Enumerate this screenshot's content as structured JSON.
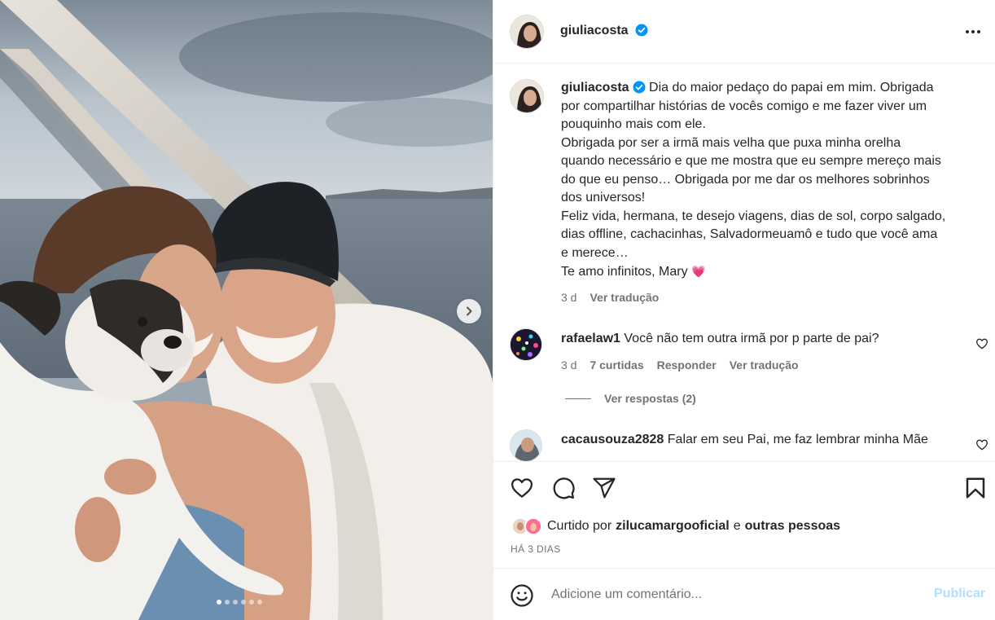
{
  "post": {
    "username": "giuliacosta",
    "verified": true,
    "caption_lines": [
      "Dia do maior pedaço do papai em mim. Obrigada",
      "por compartilhar histórias de vocês comigo e me fazer viver um",
      "pouquinho mais com ele.",
      "Obrigada por ser a irmã mais velha que puxa minha orelha",
      "quando necessário e que me mostra que eu sempre mereço mais",
      "do que eu penso… Obrigada por me dar os melhores sobrinhos",
      "dos universos!",
      "Feliz vida, hermana, te desejo viagens, dias de sol, corpo salgado,",
      "dias offline, cachacinhas, Salvadormeuamô e tudo que você ama",
      "e merece…",
      "Te amo infinitos, Mary"
    ],
    "caption_emoji": "💗",
    "caption_time": "3 d",
    "caption_translate": "Ver tradução",
    "carousel": {
      "slides": 6,
      "active_index": 0
    }
  },
  "comments": [
    {
      "username": "rafaelaw1",
      "text": "Você não tem outra irmã por p parte de pai?",
      "time": "3 d",
      "likes": "7 curtidas",
      "reply": "Responder",
      "translate": "Ver tradução",
      "view_replies": "Ver respostas (2)"
    },
    {
      "username": "cacausouza2828",
      "text": "Falar em seu Pai, me faz lembrar minha Mãe"
    }
  ],
  "likes": {
    "prefix": "Curtido por",
    "user": "zilucamargooficial",
    "connector": "e",
    "others": "outras pessoas"
  },
  "posted_time": "HÁ 3 DIAS",
  "add_comment": {
    "placeholder": "Adicione um comentário...",
    "publish": "Publicar"
  },
  "icons": {
    "more": "more-horizontal-icon",
    "like": "heart-icon",
    "comment": "comment-icon",
    "share": "paper-plane-icon",
    "save": "bookmark-icon",
    "emoji": "smiley-icon",
    "next": "chevron-right-icon",
    "verified": "verified-badge-icon"
  },
  "colors": {
    "verified_blue": "#0095f6",
    "publish_disabled": "#b2dffc",
    "heart_pink": "#ff4fa0"
  }
}
